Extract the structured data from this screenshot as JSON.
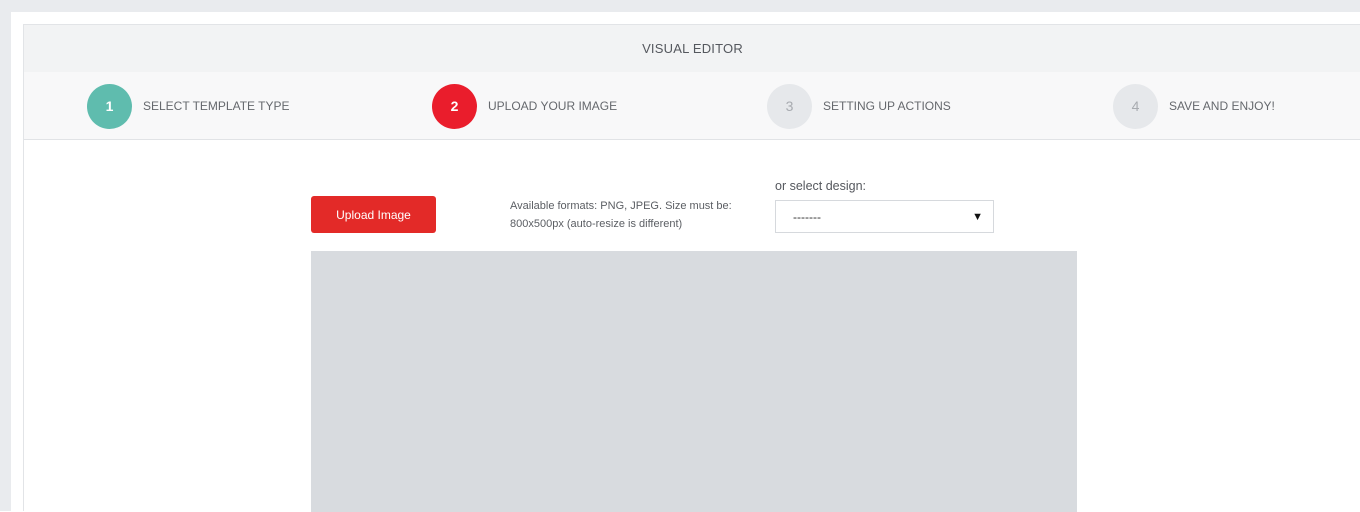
{
  "editor": {
    "title": "VISUAL EDITOR"
  },
  "steps": [
    {
      "number": "1",
      "label": "SELECT TEMPLATE TYPE",
      "state": "done"
    },
    {
      "number": "2",
      "label": "UPLOAD YOUR IMAGE",
      "state": "active"
    },
    {
      "number": "3",
      "label": "SETTING UP ACTIONS",
      "state": "pending"
    },
    {
      "number": "4",
      "label": "SAVE AND ENJOY!",
      "state": "pending"
    }
  ],
  "upload": {
    "button_label": "Upload Image",
    "formats_note": "Available formats: PNG, JPEG. Size must be: 800x500px (auto-resize is different)"
  },
  "design": {
    "label": "or select design:",
    "selected": "-------"
  },
  "colors": {
    "done": "#5fbcae",
    "active": "#ea1d2c",
    "pending": "#e6e8eb",
    "button": "#e32a28",
    "canvas": "#d8dbdf"
  },
  "icons": {
    "dropdown": "caret-down-icon"
  }
}
